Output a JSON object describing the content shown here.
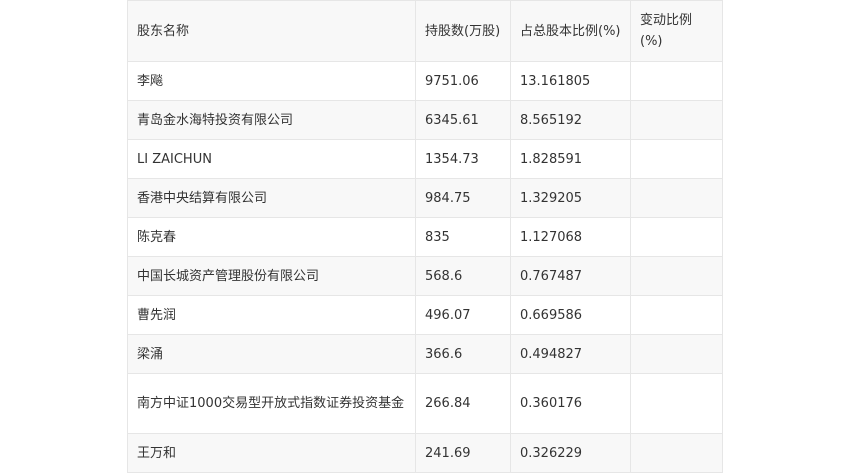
{
  "table": {
    "headers": [
      "股东名称",
      "持股数(万股)",
      "占总股本比例(%)",
      "变动比例(%)"
    ],
    "rows": [
      [
        "李飚",
        "9751.06",
        "13.161805",
        ""
      ],
      [
        "青岛金水海特投资有限公司",
        "6345.61",
        "8.565192",
        ""
      ],
      [
        "LI ZAICHUN",
        "1354.73",
        "1.828591",
        ""
      ],
      [
        "香港中央结算有限公司",
        "984.75",
        "1.329205",
        ""
      ],
      [
        "陈克春",
        "835",
        "1.127068",
        ""
      ],
      [
        "中国长城资产管理股份有限公司",
        "568.6",
        "0.767487",
        ""
      ],
      [
        "曹先润",
        "496.07",
        "0.669586",
        ""
      ],
      [
        "梁涌",
        "366.6",
        "0.494827",
        ""
      ],
      [
        "南方中证1000交易型开放式指数证券投资基金",
        "266.84",
        "0.360176",
        ""
      ],
      [
        "王万和",
        "241.69",
        "0.326229",
        ""
      ]
    ]
  }
}
